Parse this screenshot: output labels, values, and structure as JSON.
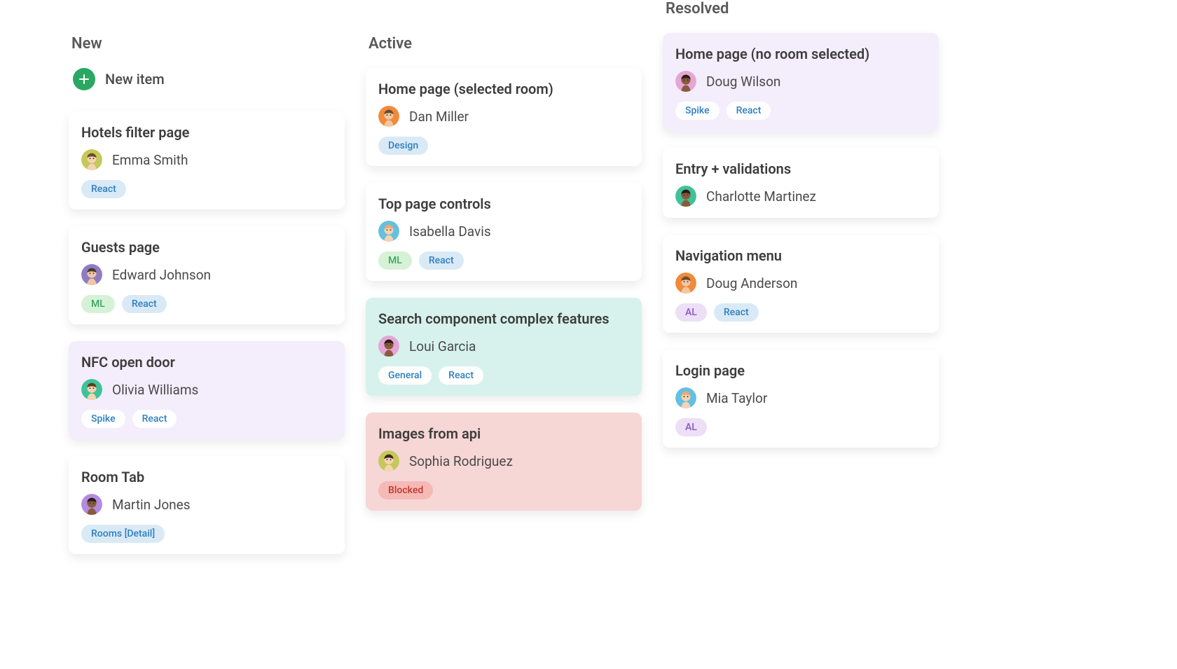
{
  "new_item_label": "New item",
  "tag_styles": {
    "React": "blue",
    "Design": "blue",
    "Rooms [Detail]": "blue",
    "General": "blue",
    "Spike": "blue",
    "ML": "green",
    "AL": "purple",
    "Blocked": "red"
  },
  "avatar_colors": {
    "Emma Smith": {
      "bg": "#c4c95a",
      "skin": "#f6d3b1",
      "hair": "#6e4b2a"
    },
    "Edward Johnson": {
      "bg": "#8e7cc3",
      "skin": "#f2c8a2",
      "hair": "#4a3a2a"
    },
    "Olivia Williams": {
      "bg": "#3fc29a",
      "skin": "#f6d3b1",
      "hair": "#5d3a1e"
    },
    "Martin Jones": {
      "bg": "#b38be0",
      "skin": "#8a5a3c",
      "hair": "#2b1d12"
    },
    "Dan Miller": {
      "bg": "#f08a3c",
      "skin": "#f2c8a2",
      "hair": "#6e4b2a"
    },
    "Isabella Davis": {
      "bg": "#63c0e0",
      "skin": "#f6d3b1",
      "hair": "#e8a87c"
    },
    "Loui Garcia": {
      "bg": "#e4a6d6",
      "skin": "#8a5a3c",
      "hair": "#2b1d12"
    },
    "Sophia Rodriguez": {
      "bg": "#c4c95a",
      "skin": "#f6d3b1",
      "hair": "#3a2a1a"
    },
    "Doug Wilson": {
      "bg": "#e4a6d6",
      "skin": "#8a5a3c",
      "hair": "#2b1d12"
    },
    "Charlotte Martinez": {
      "bg": "#3fc29a",
      "skin": "#8a5a3c",
      "hair": "#2b1d12"
    },
    "Doug Anderson": {
      "bg": "#f08a3c",
      "skin": "#f2c8a2",
      "hair": "#6e4b2a"
    },
    "Mia Taylor": {
      "bg": "#63c0e0",
      "skin": "#f6d3b1",
      "hair": "#e8a87c"
    }
  },
  "columns": [
    {
      "id": "new",
      "title": "New",
      "has_new_item": true,
      "cards": [
        {
          "title": "Hotels filter page",
          "assignee": "Emma Smith",
          "tags": [
            "React"
          ],
          "tint": ""
        },
        {
          "title": "Guests page",
          "assignee": "Edward Johnson",
          "tags": [
            "ML",
            "React"
          ],
          "tint": ""
        },
        {
          "title": "NFC open door",
          "assignee": "Olivia Williams",
          "tags": [
            "Spike",
            "React"
          ],
          "tint": "purple"
        },
        {
          "title": "Room Tab",
          "assignee": "Martin Jones",
          "tags": [
            "Rooms [Detail]"
          ],
          "tint": ""
        }
      ]
    },
    {
      "id": "active",
      "title": "Active",
      "has_new_item": false,
      "cards": [
        {
          "title": "Home page (selected room)",
          "assignee": "Dan Miller",
          "tags": [
            "Design"
          ],
          "tint": ""
        },
        {
          "title": "Top page controls",
          "assignee": "Isabella Davis",
          "tags": [
            "ML",
            "React"
          ],
          "tint": ""
        },
        {
          "title": "Search component complex features",
          "assignee": "Loui Garcia",
          "tags": [
            "General",
            "React"
          ],
          "tint": "teal"
        },
        {
          "title": "Images from api",
          "assignee": "Sophia Rodriguez",
          "tags": [
            "Blocked"
          ],
          "tint": "pink"
        }
      ]
    },
    {
      "id": "resolved",
      "title": "Resolved",
      "has_new_item": false,
      "cards": [
        {
          "title": "Home page (no room selected)",
          "assignee": "Doug Wilson",
          "tags": [
            "Spike",
            "React"
          ],
          "tint": "purple"
        },
        {
          "title": "Entry + validations",
          "assignee": "Charlotte Martinez",
          "tags": [],
          "tint": ""
        },
        {
          "title": "Navigation menu",
          "assignee": "Doug Anderson",
          "tags": [
            "AL",
            "React"
          ],
          "tint": ""
        },
        {
          "title": "Login page",
          "assignee": "Mia Taylor",
          "tags": [
            "AL"
          ],
          "tint": ""
        }
      ]
    }
  ]
}
